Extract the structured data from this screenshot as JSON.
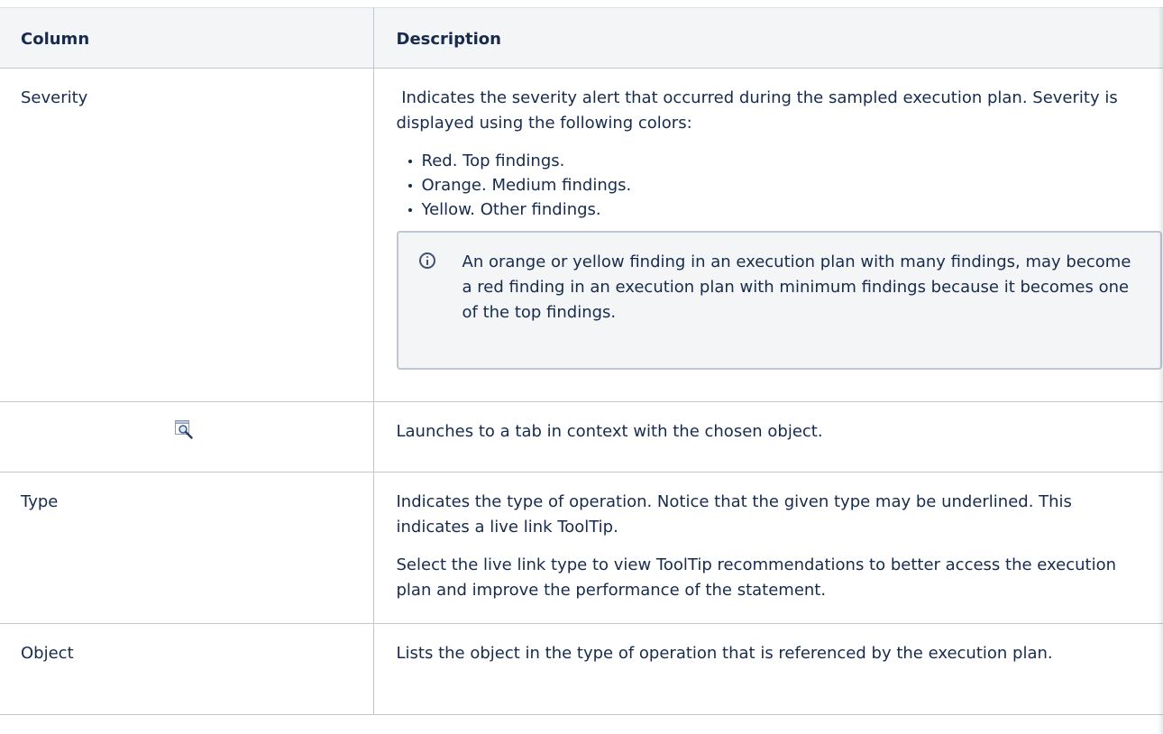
{
  "table": {
    "headers": {
      "column": "Column",
      "description": "Description"
    },
    "rows": {
      "severity": {
        "column": "Severity",
        "intro": " Indicates the severity alert that occurred during the sampled execution plan. Severity is displayed using the following colors:",
        "bullets": [
          "Red. Top findings.",
          "Orange. Medium findings.",
          "Yellow. Other findings."
        ],
        "info_note": "An orange or yellow finding in an execution plan with many findings, may become a red finding in an execution plan with minimum findings because it becomes one of the top findings."
      },
      "launch": {
        "icon": "zoom-window-icon",
        "description": "Launches to a tab in context with the chosen object."
      },
      "type": {
        "column": "Type",
        "para1": "Indicates the type of operation. Notice that the given type may be underlined. This indicates a live link ToolTip.",
        "para2": "Select the live link type to view ToolTip recommendations to better access the execution plan and improve the performance of the statement."
      },
      "object": {
        "column": "Object",
        "description": "Lists the object in the type of operation that is referenced by the execution plan."
      }
    }
  },
  "colors": {
    "text": "#172b4d",
    "header_bg": "#f4f5f7",
    "border": "#c1c7d0",
    "info_panel_bg": "#f4f5f7",
    "info_icon": "#42526e"
  }
}
